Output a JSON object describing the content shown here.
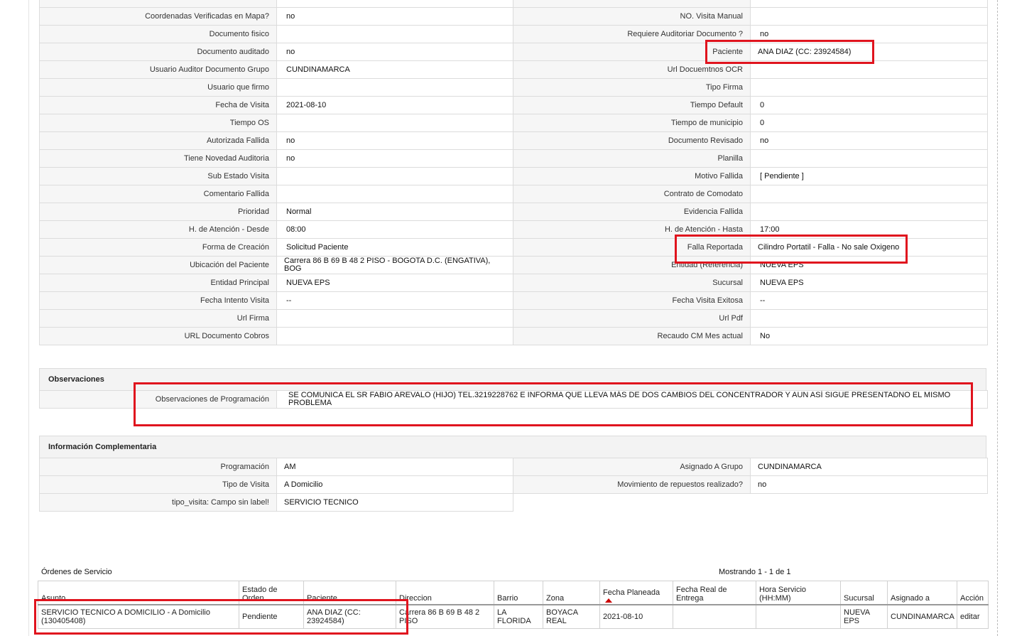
{
  "main_grid": [
    [
      "Coordenadas Verificadas en Mapa?",
      "no",
      "NO. Visita Manual",
      ""
    ],
    [
      "Documento fisico",
      "",
      "Requiere Auditoriar Documento ?",
      "no"
    ],
    [
      "Documento auditado",
      "no",
      "Paciente",
      "ANA DIAZ (CC: 23924584)"
    ],
    [
      "Usuario Auditor Documento Grupo",
      "CUNDINAMARCA",
      "Url Docuemtnos OCR",
      ""
    ],
    [
      "Usuario que firmo",
      "",
      "Tipo Firma",
      ""
    ],
    [
      "Fecha de Visita",
      "2021-08-10",
      "Tiempo Default",
      "0"
    ],
    [
      "Tiempo OS",
      "",
      "Tiempo de municipio",
      "0"
    ],
    [
      "Autorizada Fallida",
      "no",
      "Documento Revisado",
      "no"
    ],
    [
      "Tiene Novedad Auditoria",
      "no",
      "Planilla",
      ""
    ],
    [
      "Sub Estado Visita",
      "",
      "Motivo Fallida",
      "[ Pendiente ]"
    ],
    [
      "Comentario Fallida",
      "",
      "Contrato de Comodato",
      ""
    ],
    [
      "Prioridad",
      "Normal",
      "Evidencia Fallida",
      ""
    ],
    [
      "H. de Atención - Desde",
      "08:00",
      "H. de Atención - Hasta",
      "17:00"
    ],
    [
      "Forma de Creación",
      "Solicitud Paciente",
      "Falla Reportada",
      "Cilindro Portatil - Falla - No sale Oxigeno"
    ],
    [
      "Ubicación del Paciente",
      "Carrera 86 B 69 B 48 2 PISO - BOGOTA D.C. (ENGATIVA), BOG",
      "Entidad (Referencia)",
      "NUEVA EPS"
    ],
    [
      "Entidad Principal",
      "NUEVA EPS",
      "Sucursal",
      "NUEVA EPS"
    ],
    [
      "Fecha Intento Visita",
      "--",
      "Fecha Visita Exitosa",
      "--"
    ],
    [
      "Url Firma",
      "",
      "Url Pdf",
      ""
    ],
    [
      "URL Documento Cobros",
      "",
      "Recaudo CM Mes actual",
      "No"
    ]
  ],
  "observaciones": {
    "title": "Observaciones",
    "label": "Observaciones de Programación",
    "value": "SE COMUNICA EL SR FABIO AREVALO (HIJO) TEL.3219228762 E INFORMA QUE LLEVA MÁS DE DOS CAMBIOS DEL CONCENTRADOR Y AUN ASÍ SIGUE PRESENTADNO EL MISMO PROBLEMA"
  },
  "info_complementaria": {
    "title": "Información Complementaria",
    "rows": [
      [
        "Programación",
        "AM",
        "Asignado A Grupo",
        "CUNDINAMARCA"
      ],
      [
        "Tipo de Visita",
        "A Domicilio",
        "Movimiento de repuestos realizado?",
        "no"
      ],
      [
        "tipo_visita: Campo sin label!",
        "SERVICIO TECNICO",
        null,
        null
      ]
    ]
  },
  "ordenes": {
    "title": "Órdenes de Servicio",
    "count_text": "Mostrando 1 - 1 de 1",
    "columns": [
      "Asunto",
      "Estado de Orden",
      "Paciente",
      "Direccion",
      "Barrio",
      "Zona",
      "Fecha Planeada",
      "Fecha Real de Entrega",
      "Hora Servicio (HH:MM)",
      "Sucursal",
      "Asignado a",
      "Acción"
    ],
    "rows": [
      [
        "SERVICIO TECNICO A DOMICILIO - A Domicilio (130405408)",
        "Pendiente",
        "ANA DIAZ (CC: 23924584)",
        "Carrera 86 B 69 B 48 2 PISO",
        "LA FLORIDA",
        "BOYACA REAL",
        "2021-08-10",
        "",
        "",
        "NUEVA EPS",
        "CUNDINAMARCA",
        "editar"
      ]
    ]
  },
  "highlight_color": "#e0141e"
}
